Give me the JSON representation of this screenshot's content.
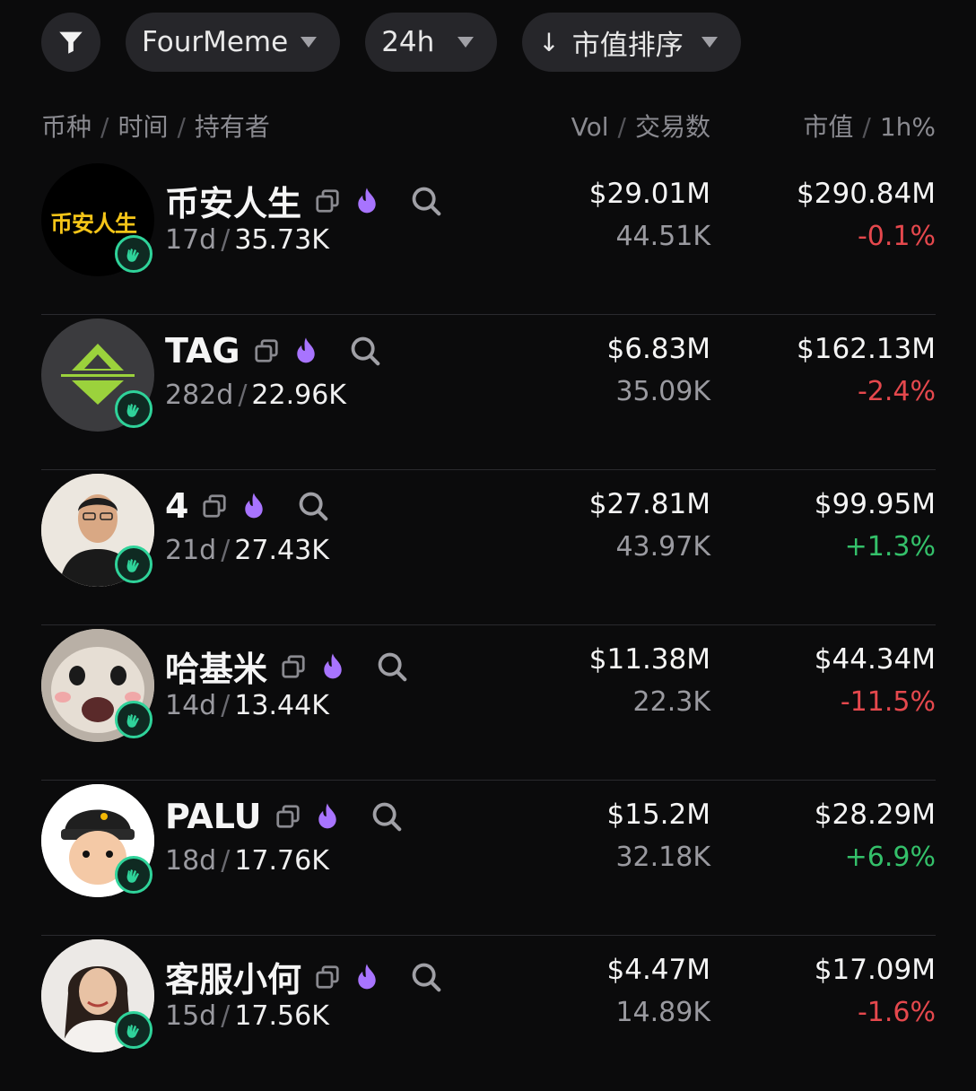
{
  "filters": {
    "platform": "FourMeme",
    "timeframe": "24h",
    "sort_arrow": "↓",
    "sort": "市值排序"
  },
  "header": {
    "coin": "币种",
    "time": "时间",
    "holders": "持有者",
    "vol": "Vol",
    "txns": "交易数",
    "mcap": "市值",
    "change": "1h%"
  },
  "colors": {
    "negative": "#e5484d",
    "positive": "#34c06a",
    "hot_icon": "#a874ff",
    "badge_accent": "#2fd39a"
  },
  "tokens": [
    {
      "name": "币安人生",
      "avatar_text": "币安人生",
      "age": "17d",
      "holders": "35.73K",
      "vol": "$29.01M",
      "txns": "44.51K",
      "mcap": "$290.84M",
      "change": "-0.1%",
      "dir": "neg"
    },
    {
      "name": "TAG",
      "avatar_text": "",
      "age": "282d",
      "holders": "22.96K",
      "vol": "$6.83M",
      "txns": "35.09K",
      "mcap": "$162.13M",
      "change": "-2.4%",
      "dir": "neg"
    },
    {
      "name": "4",
      "avatar_text": "",
      "age": "21d",
      "holders": "27.43K",
      "vol": "$27.81M",
      "txns": "43.97K",
      "mcap": "$99.95M",
      "change": "+1.3%",
      "dir": "pos"
    },
    {
      "name": "哈基米",
      "avatar_text": "",
      "age": "14d",
      "holders": "13.44K",
      "vol": "$11.38M",
      "txns": "22.3K",
      "mcap": "$44.34M",
      "change": "-11.5%",
      "dir": "neg"
    },
    {
      "name": "PALU",
      "avatar_text": "",
      "age": "18d",
      "holders": "17.76K",
      "vol": "$15.2M",
      "txns": "32.18K",
      "mcap": "$28.29M",
      "change": "+6.9%",
      "dir": "pos"
    },
    {
      "name": "客服小何",
      "avatar_text": "",
      "age": "15d",
      "holders": "17.56K",
      "vol": "$4.47M",
      "txns": "14.89K",
      "mcap": "$17.09M",
      "change": "-1.6%",
      "dir": "neg"
    }
  ]
}
